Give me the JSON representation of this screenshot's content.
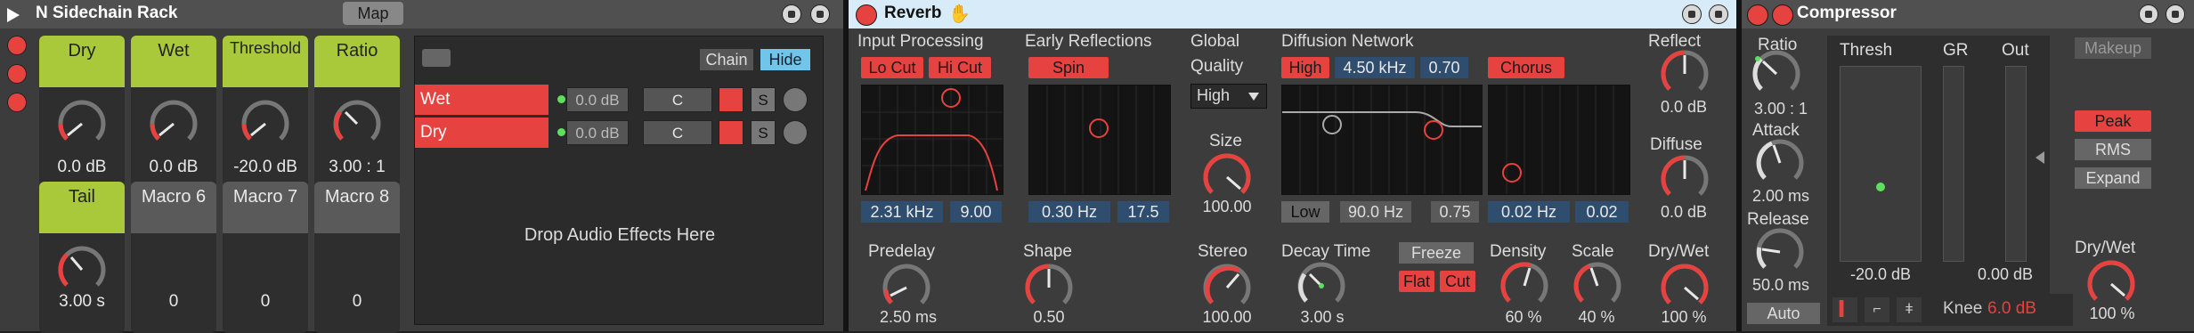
{
  "rack": {
    "title": "N Sidechain Rack",
    "map_label": "Map",
    "chain_label": "Chain",
    "hide_label": "Hide",
    "macros": [
      {
        "label": "Dry",
        "value": "0.0 dB",
        "assigned": true
      },
      {
        "label": "Wet",
        "value": "0.0 dB",
        "assigned": true
      },
      {
        "label": "Threshold",
        "value": "-20.0 dB",
        "assigned": true
      },
      {
        "label": "Ratio",
        "value": "3.00 : 1",
        "assigned": true
      },
      {
        "label": "Tail",
        "value": "3.00 s",
        "assigned": true
      },
      {
        "label": "Macro 6",
        "value": "0",
        "assigned": false
      },
      {
        "label": "Macro 7",
        "value": "0",
        "assigned": false
      },
      {
        "label": "Macro 8",
        "value": "0",
        "assigned": false
      }
    ],
    "chains": [
      {
        "name": "Wet",
        "volume": "0.0 dB",
        "pan": "C",
        "solo": "S"
      },
      {
        "name": "Dry",
        "volume": "0.0 dB",
        "pan": "C",
        "solo": "S"
      }
    ],
    "drop_text": "Drop Audio Effects Here"
  },
  "reverb": {
    "title": "Reverb",
    "input_processing": {
      "title": "Input Processing",
      "low_cut": "Lo Cut",
      "hi_cut": "Hi Cut",
      "freq": "2.31 kHz",
      "width": "9.00"
    },
    "early_reflections": {
      "title": "Early Reflections",
      "spin": "Spin",
      "rate": "0.30 Hz",
      "amount": "17.5"
    },
    "global": {
      "title": "Global",
      "quality_label": "Quality",
      "quality_value": "High"
    },
    "diffusion": {
      "title": "Diffusion Network",
      "high": "High",
      "high_freq": "4.50 kHz",
      "high_amount": "0.70",
      "chorus": "Chorus",
      "low": "Low",
      "low_freq": "90.0 Hz",
      "low_amount": "0.75",
      "chorus_rate": "0.02 Hz",
      "chorus_amount": "0.02"
    },
    "reflect": {
      "label": "Reflect",
      "value": "0.0 dB"
    },
    "diffuse": {
      "label": "Diffuse",
      "value": "0.0 dB"
    },
    "predelay": {
      "label": "Predelay",
      "value": "2.50 ms"
    },
    "shape": {
      "label": "Shape",
      "value": "0.50"
    },
    "size": {
      "label": "Size",
      "value": "100.00"
    },
    "stereo": {
      "label": "Stereo",
      "value": "100.00"
    },
    "decay": {
      "label": "Decay Time",
      "value": "3.00 s"
    },
    "freeze": "Freeze",
    "flat": "Flat",
    "cut": "Cut",
    "density": {
      "label": "Density",
      "value": "60 %"
    },
    "scale": {
      "label": "Scale",
      "value": "40 %"
    },
    "drywet": {
      "label": "Dry/Wet",
      "value": "100 %"
    }
  },
  "compressor": {
    "title": "Compressor",
    "ratio": {
      "label": "Ratio",
      "value": "3.00 : 1"
    },
    "attack": {
      "label": "Attack",
      "value": "2.00 ms"
    },
    "release": {
      "label": "Release",
      "value": "50.0 ms"
    },
    "auto": "Auto",
    "thresh_label": "Thresh",
    "gr_label": "GR",
    "out_label": "Out",
    "thresh_value": "-20.0 dB",
    "out_value": "0.00 dB",
    "knee_label": "Knee",
    "knee_value": "6.0 dB",
    "makeup": "Makeup",
    "peak": "Peak",
    "rms": "RMS",
    "expand": "Expand",
    "drywet": {
      "label": "Dry/Wet",
      "value": "100 %"
    }
  },
  "colors": {
    "accent_red": "#e6423f",
    "macro_green": "#a9c93b",
    "selected_title": "#d7ecf8",
    "value_blue": "#2f4d6e"
  }
}
